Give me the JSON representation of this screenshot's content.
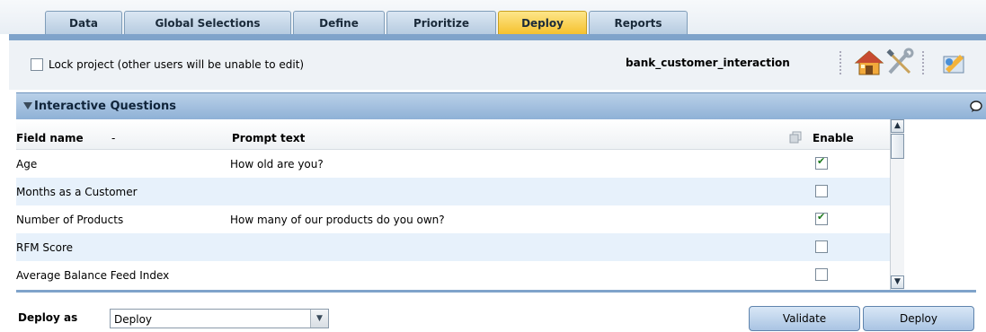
{
  "tabs": [
    {
      "label": "Data",
      "active": false
    },
    {
      "label": "Global Selections",
      "active": false
    },
    {
      "label": "Define",
      "active": false
    },
    {
      "label": "Prioritize",
      "active": false
    },
    {
      "label": "Deploy",
      "active": true
    },
    {
      "label": "Reports",
      "active": false
    }
  ],
  "toolbar": {
    "lock_label": "Lock project (other users will be unable to edit)",
    "lock_checked": false,
    "project_name": "bank_customer_interaction",
    "icons": [
      "home-icon",
      "tools-icon",
      "deploy-icon"
    ]
  },
  "panel": {
    "title": "Interactive Questions",
    "columns": {
      "field": "Field name",
      "sort_indicator": "-",
      "prompt": "Prompt text",
      "enable": "Enable"
    },
    "rows": [
      {
        "field": "Age",
        "prompt": "How old are you?",
        "enabled": true
      },
      {
        "field": "Months as a Customer",
        "prompt": "",
        "enabled": false
      },
      {
        "field": "Number of Products",
        "prompt": "How many of our products do you own?",
        "enabled": true
      },
      {
        "field": "RFM Score",
        "prompt": "",
        "enabled": false
      },
      {
        "field": "Average Balance Feed Index",
        "prompt": "",
        "enabled": false
      }
    ]
  },
  "footer": {
    "deploy_as_label": "Deploy as",
    "deploy_as_value": "Deploy",
    "validate_label": "Validate",
    "deploy_label": "Deploy"
  },
  "colors": {
    "accent": "#7fa3ca",
    "active_tab": "#f5c12e",
    "alt_row": "#e7f1fb"
  }
}
